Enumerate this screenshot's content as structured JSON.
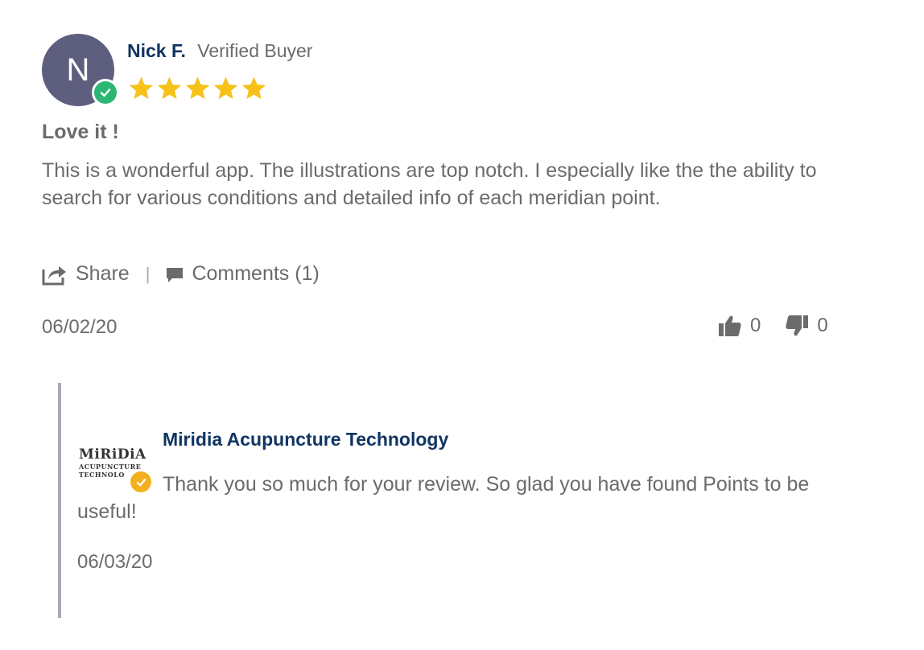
{
  "review": {
    "avatar_initial": "N",
    "author_name": "Nick F.",
    "verified_label": "Verified Buyer",
    "rating": 5,
    "rating_max": 5,
    "title": "Love it !",
    "body": "This is a wonderful app. The illustrations are top notch. I especially like the the ability to search for various conditions and detailed info of each meridian point.",
    "share_label": "Share",
    "comments_label": "Comments (1)",
    "date": "06/02/20",
    "thumbs_up_count": "0",
    "thumbs_down_count": "0"
  },
  "reply": {
    "logo_line1": "MiRiDiA",
    "logo_line2": "ACUPUNCTURE",
    "logo_line3": "TECHNOLO",
    "author_name": "Miridia Acupuncture Technology",
    "text": "Thank you so much for your review. So glad you have found Points to be useful!",
    "date": "06/03/20"
  },
  "colors": {
    "author_name": "#0f3563",
    "star": "#f6c21a",
    "verified_badge": "#2bb673",
    "reply_badge": "#f2b01e",
    "avatar_bg": "#5e5f7f",
    "text": "#6b6b6b"
  },
  "icons": [
    "verified-check-icon",
    "star-icon",
    "share-icon",
    "comment-icon",
    "thumbs-up-icon",
    "thumbs-down-icon"
  ]
}
